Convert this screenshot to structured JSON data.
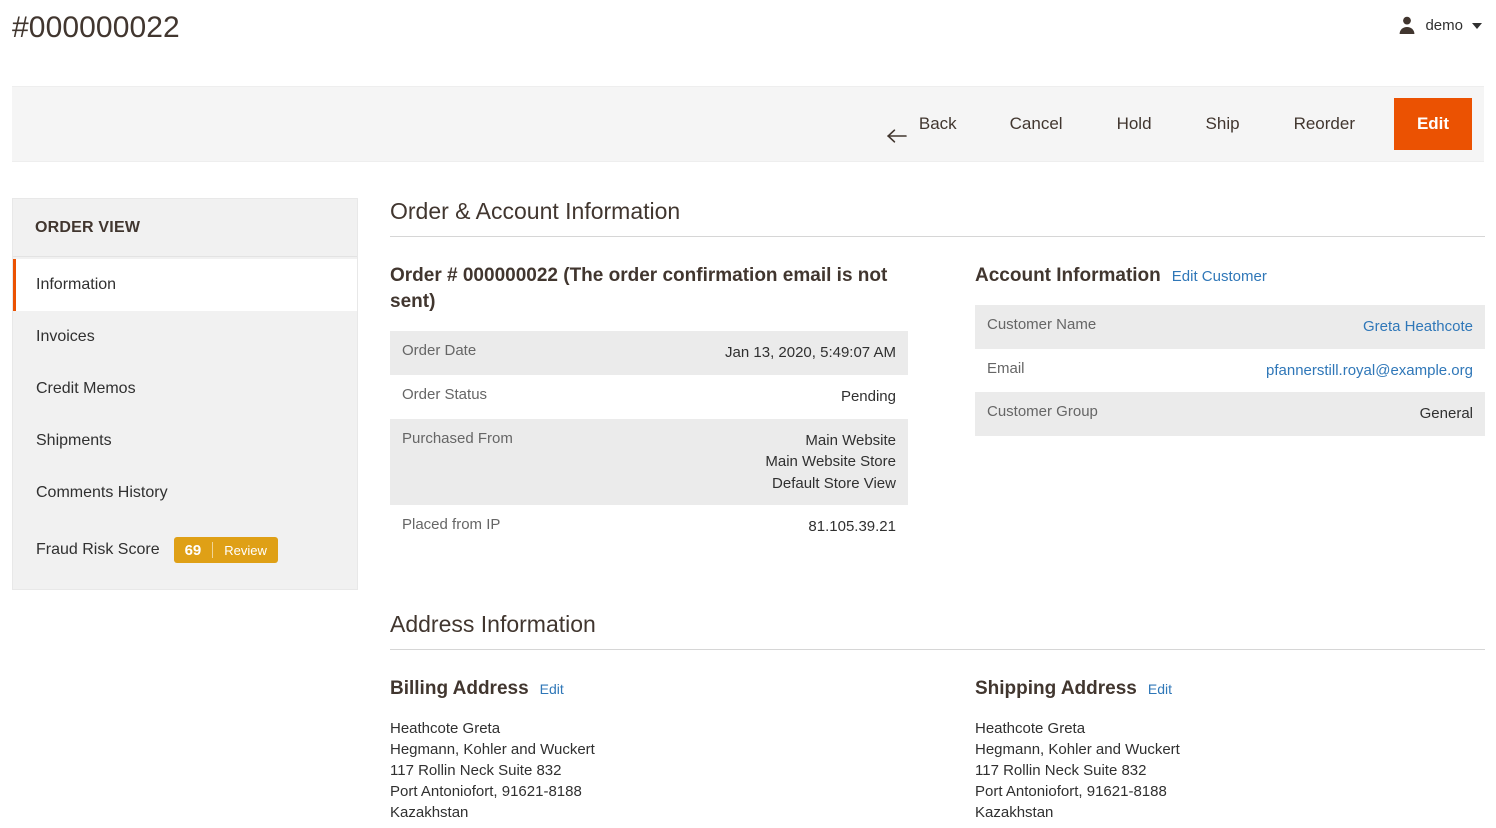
{
  "header": {
    "title": "#000000022",
    "user": {
      "icon": "user-icon",
      "name": "demo",
      "caret": "chevron-down-icon"
    }
  },
  "toolbar": {
    "back_label": "Back",
    "back_icon": "arrow-left-icon",
    "cancel_label": "Cancel",
    "hold_label": "Hold",
    "ship_label": "Ship",
    "reorder_label": "Reorder",
    "edit_label": "Edit",
    "edit_color": "#eb5202"
  },
  "sidebar": {
    "title": "ORDER VIEW",
    "items": [
      {
        "label": "Information",
        "active": true
      },
      {
        "label": "Invoices",
        "active": false
      },
      {
        "label": "Credit Memos",
        "active": false
      },
      {
        "label": "Shipments",
        "active": false
      },
      {
        "label": "Comments History",
        "active": false
      }
    ],
    "fraud": {
      "label": "Fraud Risk Score",
      "score": "69",
      "action": "Review",
      "badge_color": "#dfa016"
    }
  },
  "order_account_section": {
    "title": "Order & Account Information",
    "order": {
      "heading": "Order # 000000022 (The order confirmation email is not sent)",
      "rows": [
        {
          "label": "Order Date",
          "value": "Jan 13, 2020, 5:49:07 AM"
        },
        {
          "label": "Order Status",
          "value": "Pending"
        },
        {
          "label": "Purchased From",
          "value": "Main Website\nMain Website Store\nDefault Store View"
        },
        {
          "label": "Placed from IP",
          "value": "81.105.39.21"
        }
      ]
    },
    "account": {
      "heading": "Account Information",
      "edit_link": "Edit Customer",
      "rows": [
        {
          "label": "Customer Name",
          "value": "Greta Heathcote",
          "is_link": true
        },
        {
          "label": "Email",
          "value": "pfannerstill.royal@example.org",
          "is_link": true
        },
        {
          "label": "Customer Group",
          "value": "General",
          "is_link": false
        }
      ]
    }
  },
  "address_section": {
    "title": "Address Information",
    "billing": {
      "heading": "Billing Address",
      "edit_link": "Edit",
      "lines": [
        "Heathcote Greta",
        "Hegmann, Kohler and Wuckert",
        "117 Rollin Neck Suite 832",
        "Port Antoniofort, 91621-8188",
        "Kazakhstan"
      ]
    },
    "shipping": {
      "heading": "Shipping Address",
      "edit_link": "Edit",
      "lines": [
        "Heathcote Greta",
        "Hegmann, Kohler and Wuckert",
        "117 Rollin Neck Suite 832",
        "Port Antoniofort, 91621-8188",
        "Kazakhstan"
      ]
    }
  }
}
